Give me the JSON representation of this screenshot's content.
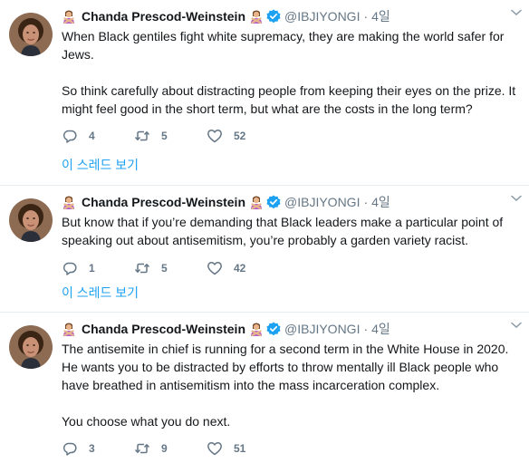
{
  "tweets": [
    {
      "name": "Chanda Prescod-Weinstein",
      "handle": "@IBJIYONGI",
      "separator": "·",
      "time": "4일",
      "paragraphs": [
        "When Black gentiles fight white supremacy, they are making the world safer for",
        "Jews.",
        "",
        "So think carefully about distracting people from keeping their eyes on the prize. It",
        "might feel good in the short term, but what are the costs in the long term?"
      ],
      "replies": "4",
      "retweets": "5",
      "likes": "52",
      "thread_link": "이 스레드 보기"
    },
    {
      "name": "Chanda Prescod-Weinstein",
      "handle": "@IBJIYONGI",
      "separator": "·",
      "time": "4일",
      "paragraphs": [
        "But know that if you’re demanding that Black leaders make a particular point of",
        "speaking out about antisemitism, you’re probably a garden variety racist."
      ],
      "replies": "1",
      "retweets": "5",
      "likes": "42",
      "thread_link": "이 스레드 보기"
    },
    {
      "name": "Chanda Prescod-Weinstein",
      "handle": "@IBJIYONGI",
      "separator": "·",
      "time": "4일",
      "paragraphs": [
        "The antisemite in chief is running for a second term in the White House in 2020.",
        "He wants you to be distracted by efforts to throw mentally ill Black people who",
        "have breathed in antisemitism into the mass incarceration complex.",
        "",
        "You choose what you do next."
      ],
      "replies": "3",
      "retweets": "9",
      "likes": "51"
    }
  ],
  "icons": {
    "name_emoji": "woman-gesturing-no-emoji",
    "verified": "verified-badge-icon",
    "reply": "reply-icon",
    "retweet": "retweet-icon",
    "like": "heart-icon",
    "menu": "chevron-down-icon"
  },
  "colors": {
    "text": "#14171a",
    "secondary": "#657786",
    "link": "#1da1f2",
    "divider": "#e6ecf0",
    "verified": "#1da1f2"
  }
}
